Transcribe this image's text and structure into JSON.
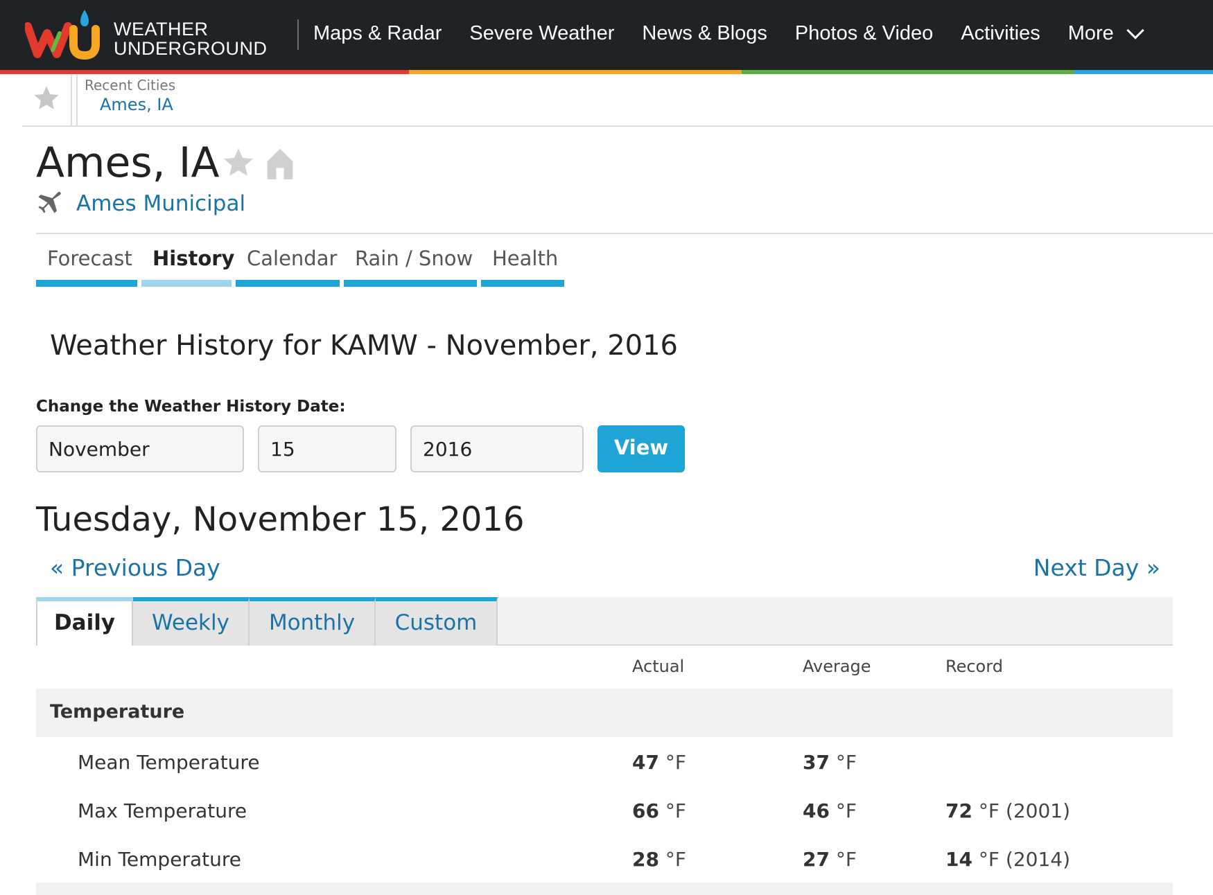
{
  "brand": {
    "line1": "WEATHER",
    "line2": "UNDERGROUND",
    "colors": [
      "#e23b2e",
      "#f6a623",
      "#2aa4dc",
      "#63b946",
      "#1f2326"
    ]
  },
  "nav": {
    "links": [
      {
        "label": "Maps & Radar"
      },
      {
        "label": "Severe Weather"
      },
      {
        "label": "News & Blogs"
      },
      {
        "label": "Photos & Video"
      },
      {
        "label": "Activities"
      },
      {
        "label": "More"
      }
    ],
    "rainbow": [
      "#e23b2e",
      "#f28d1e",
      "#f6c744",
      "#5cae47",
      "#2aa4dc"
    ]
  },
  "recent": {
    "label": "Recent Cities",
    "city": "Ames, IA",
    "icon": "star-icon"
  },
  "location": {
    "city": "Ames, IA",
    "station": "Ames Municipal",
    "icons": [
      "star-icon",
      "home-icon",
      "airplane-icon"
    ]
  },
  "section_tabs": [
    {
      "label": "Forecast",
      "active": false
    },
    {
      "label": "History",
      "active": true
    },
    {
      "label": "Calendar",
      "active": false
    },
    {
      "label": "Rain / Snow",
      "active": false
    },
    {
      "label": "Health",
      "active": false
    }
  ],
  "history": {
    "heading": "Weather History for KAMW - November, 2016",
    "change_label": "Change the Weather History Date:",
    "month": "November",
    "day": "15",
    "year": "2016",
    "view_label": "View",
    "date_title": "Tuesday, November 15, 2016",
    "prev_label": "« Previous Day",
    "next_label": "Next Day »"
  },
  "period_tabs": [
    {
      "label": "Daily",
      "active": true
    },
    {
      "label": "Weekly",
      "active": false
    },
    {
      "label": "Monthly",
      "active": false
    },
    {
      "label": "Custom",
      "active": false
    }
  ],
  "table": {
    "columns": [
      "Actual",
      "Average",
      "Record"
    ],
    "group": "Temperature",
    "rows": [
      {
        "label": "Mean Temperature",
        "actual": "47",
        "average": "37",
        "record": "",
        "record_year": ""
      },
      {
        "label": "Max Temperature",
        "actual": "66",
        "average": "46",
        "record": "72",
        "record_year": "(2001)"
      },
      {
        "label": "Min Temperature",
        "actual": "28",
        "average": "27",
        "record": "14",
        "record_year": "(2014)"
      }
    ],
    "unit": "°F"
  },
  "accent": "#1fa4d6",
  "link_color": "#1a73a8"
}
